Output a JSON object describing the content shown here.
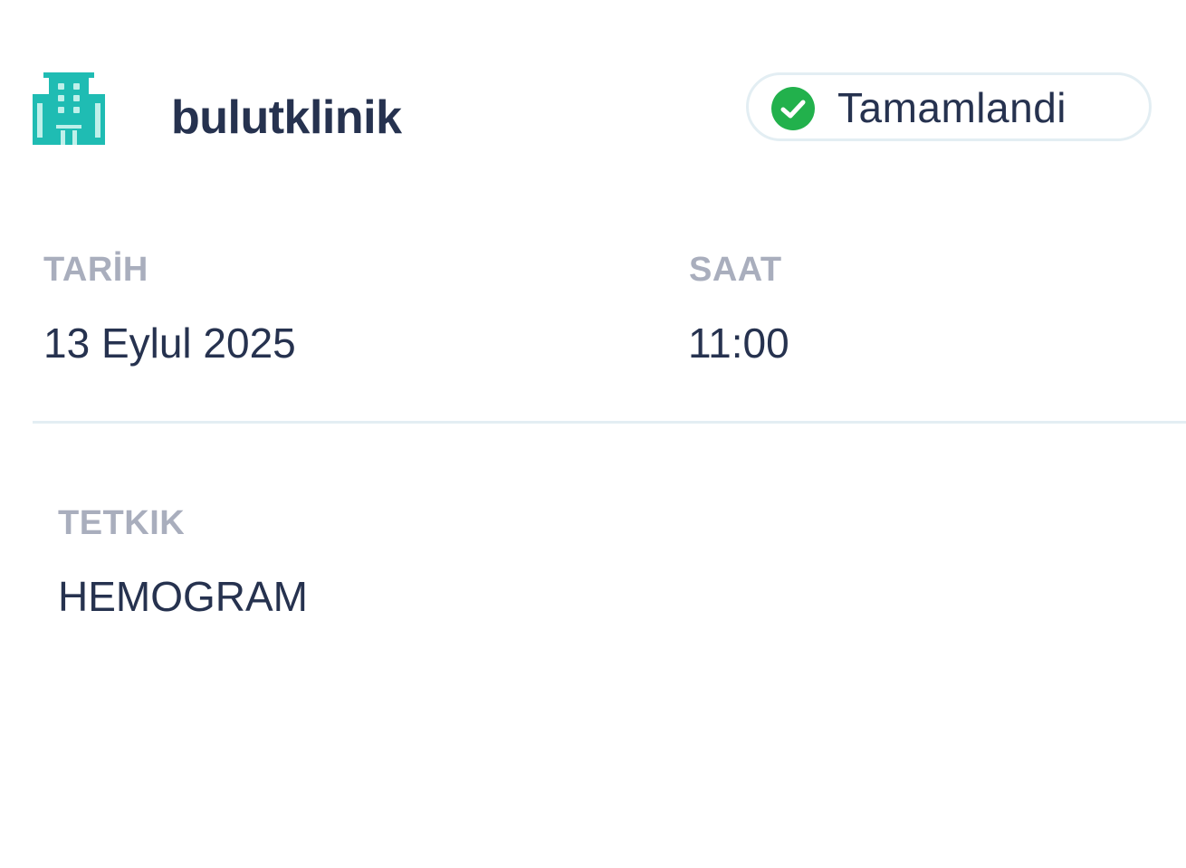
{
  "header": {
    "clinic_logo_icon": "hospital-building-icon",
    "clinic_name": "bulutklinik",
    "status": {
      "icon": "check-circle-icon",
      "label": "Tamamlandi",
      "color": "#22b14c"
    }
  },
  "appointment": {
    "date_label": "TARİH",
    "date_value": "13 Eylul 2025",
    "time_label": "SAAT",
    "time_value": "11:00"
  },
  "test": {
    "label": "TETKIK",
    "value": "HEMOGRAM"
  },
  "colors": {
    "brand_teal": "#1fbcb3",
    "text_dark": "#26324f",
    "label_gray": "#a9aebd",
    "divider": "#e3eef3",
    "success_green": "#22b14c"
  }
}
